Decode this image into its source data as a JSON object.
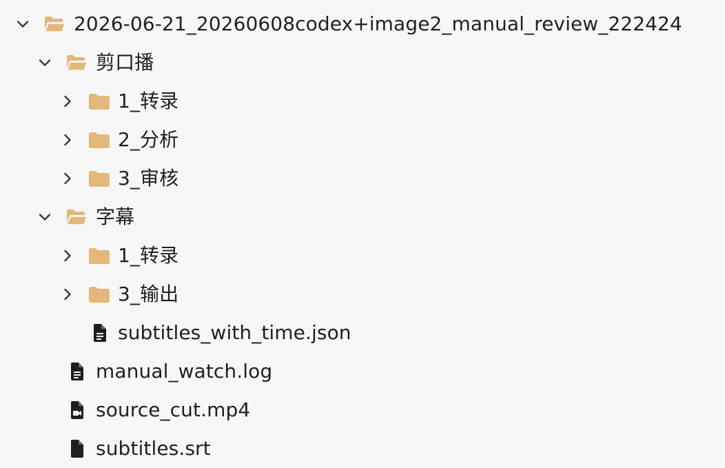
{
  "colors": {
    "background": "#f7f7f7",
    "text": "#1f1f1f",
    "folder": "#e3b878",
    "chevron": "#3a3a3a",
    "file_icon": "#1e1e1e"
  },
  "tree": {
    "root": {
      "label": "2026-06-21_20260608codex+image2_manual_review_222424",
      "expanded": true,
      "icon": "folder-open-icon",
      "children": [
        {
          "label": "剪口播",
          "expanded": true,
          "icon": "folder-open-icon",
          "children": [
            {
              "label": "1_转录",
              "expanded": false,
              "icon": "folder-icon"
            },
            {
              "label": "2_分析",
              "expanded": false,
              "icon": "folder-icon"
            },
            {
              "label": "3_审核",
              "expanded": false,
              "icon": "folder-icon"
            }
          ]
        },
        {
          "label": "字幕",
          "expanded": true,
          "icon": "folder-open-icon",
          "children": [
            {
              "label": "1_转录",
              "expanded": false,
              "icon": "folder-icon"
            },
            {
              "label": "3_输出",
              "expanded": false,
              "icon": "folder-icon"
            },
            {
              "label": "subtitles_with_time.json",
              "icon": "document-icon"
            }
          ]
        },
        {
          "label": "manual_watch.log",
          "icon": "document-icon"
        },
        {
          "label": "source_cut.mp4",
          "icon": "video-file-icon"
        },
        {
          "label": "subtitles.srt",
          "icon": "file-icon"
        }
      ]
    }
  }
}
